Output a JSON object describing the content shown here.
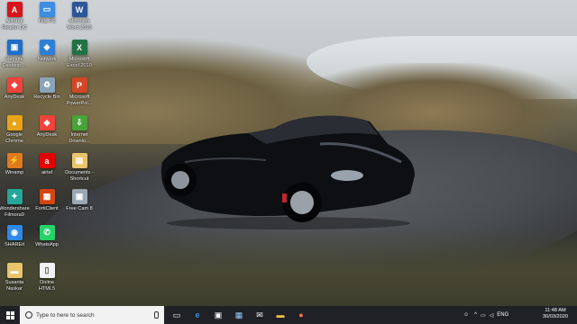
{
  "desktop": {
    "icons": [
      {
        "label": "Acrobat\nReader DC",
        "icon": "acrobat-icon",
        "color": "#d7141a",
        "glyph": "A"
      },
      {
        "label": "This PC",
        "icon": "this-pc-icon",
        "color": "#3b8ee0",
        "glyph": "▭"
      },
      {
        "label": "Microsoft\nWord 2010",
        "icon": "word-icon",
        "color": "#2b579a",
        "glyph": "W"
      },
      {
        "label": "Remote\nDesktop ...",
        "icon": "remote-desktop-icon",
        "color": "#1e6fc8",
        "glyph": "▣"
      },
      {
        "label": "Network",
        "icon": "network-icon",
        "color": "#2f7fd6",
        "glyph": "◈"
      },
      {
        "label": "Microsoft\nExcel 2010",
        "icon": "excel-icon",
        "color": "#217346",
        "glyph": "X"
      },
      {
        "label": "AnyDesk",
        "icon": "anydesk-icon",
        "color": "#ef443b",
        "glyph": "◆"
      },
      {
        "label": "Recycle Bin",
        "icon": "recycle-bin-icon",
        "color": "#8aa3b8",
        "glyph": "♻"
      },
      {
        "label": "Microsoft\nPowerPoi...",
        "icon": "powerpoint-icon",
        "color": "#d24726",
        "glyph": "P"
      },
      {
        "label": "Google\nChrome",
        "icon": "chrome-icon",
        "color": "#e8a317",
        "glyph": "●"
      },
      {
        "label": "AnyDesk",
        "icon": "anydesk-icon",
        "color": "#ef443b",
        "glyph": "◆"
      },
      {
        "label": "Internet\nDownlo...",
        "icon": "internet-download-manager-icon",
        "color": "#4aa23b",
        "glyph": "⇩"
      },
      {
        "label": "Winamp",
        "icon": "winamp-icon",
        "color": "#e07a1b",
        "glyph": "⚡"
      },
      {
        "label": "airtel",
        "icon": "airtel-icon",
        "color": "#e40000",
        "glyph": "a"
      },
      {
        "label": "Documents -\nShortcut",
        "icon": "documents-shortcut-icon",
        "color": "#e9c46a",
        "glyph": "▤"
      },
      {
        "label": "Wondershare\nFilmora9",
        "icon": "filmora-icon",
        "color": "#26a69a",
        "glyph": "✦"
      },
      {
        "label": "FortiClient",
        "icon": "forticlient-icon",
        "color": "#d4460f",
        "glyph": "▦"
      },
      {
        "label": "Free Cam 8",
        "icon": "free-cam-icon",
        "color": "#9aa8b6",
        "glyph": "▣"
      },
      {
        "label": "SHAREit",
        "icon": "shareit-icon",
        "color": "#2d8ae6",
        "glyph": "◉"
      },
      {
        "label": "WhatsApp",
        "icon": "whatsapp-icon",
        "color": "#25d366",
        "glyph": "✆"
      },
      {
        "label": "Susanta\nNaskar",
        "icon": "user-folder-icon",
        "color": "#e8c56b",
        "glyph": "▬"
      },
      {
        "label": "Online\nHTML5",
        "icon": "document-icon",
        "color": "#f2f2f2",
        "glyph": "▯"
      }
    ]
  },
  "taskbar": {
    "search_placeholder": "Type to here to search",
    "pinned": [
      "task-view-icon",
      "edge-icon",
      "store-icon",
      "photos-icon",
      "mail-icon",
      "file-explorer-icon",
      "firefox-icon"
    ],
    "tray": {
      "language": "ENG"
    },
    "clock": {
      "time": "11:48 AM",
      "date": "30/03/2020"
    }
  }
}
